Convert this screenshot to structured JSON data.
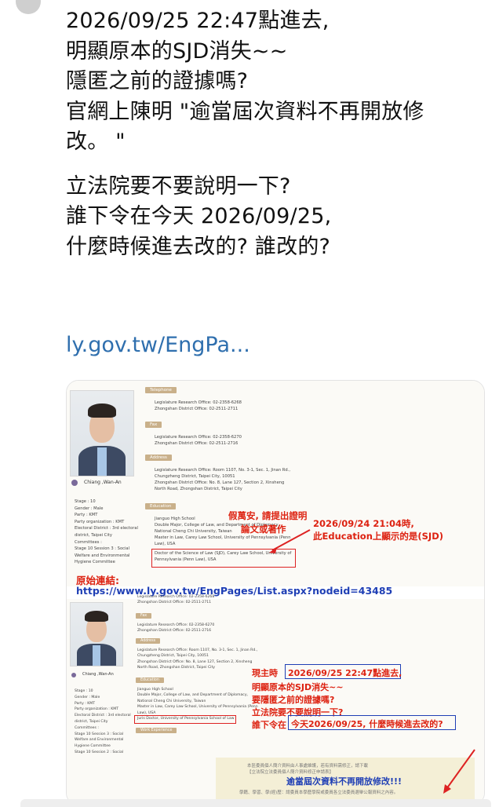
{
  "post": {
    "lines": [
      "2026/09/25 22:47點進去,",
      "明顯原本的SJD消失~~",
      "隱匿之前的證據嗎?",
      "官網上陳明 \"逾當屆次資料不再開放修",
      "改。 \"",
      "立法院要不要說明一下?",
      "誰下令在今天 2026/09/25,",
      "什麼時候進去改的? 誰改的?"
    ],
    "link": "ly.gov.tw/EngPa..."
  },
  "panel1": {
    "name": "Chiang ,Wan-An",
    "profile": [
      "Stage : 10",
      "Gender : Male",
      "Party : KMT",
      "Party organization : KMT",
      "Electoral District : 3rd electoral",
      "district, Taipei City",
      "Committees :",
      "Stage 10 Session 3 : Social",
      "Welfare and Environmental",
      "Hygiene Committee"
    ],
    "sections": {
      "telephone": "Telephone",
      "fax": "Fax",
      "address": "Address",
      "education": "Education"
    },
    "telephone": [
      "Legislature Research Office: 02-2358-6268",
      "Zhongshan District Office: 02-2511-2711"
    ],
    "fax": [
      "Legislature Research Office: 02-2358-6270",
      "Zhongshan District Office: 02-2511-2716"
    ],
    "address": [
      "Legislature Research Office: Room 1107, No. 3-1, Sec. 1, Jinan Rd.,",
      "Chungzheng District, Taipei City, 10051",
      "Zhongshan District Office: No. 8, Lane 127, Section 2, Xinsheng",
      "North Road, Zhongshan District, Taipei City"
    ],
    "education": [
      "Jianguo High School",
      "Double Major, College of Law, and Department of Diplomacy,",
      "National Cheng Chi University, Taiwan",
      "Master in Law, Carey Law School, University of Pennsylvania (Penn",
      "Law), USA",
      "Doctor of the Science of Law (SJD), Carey Law School, University of",
      "Pennsylvania (Penn Law), USA"
    ],
    "annotation_red1": "假萬安, 請提出證明",
    "annotation_red2": "論文或著作",
    "annotation_red3": "2026/09/24 21:04時,",
    "annotation_red4": "此Education上顯示的是(SJD)",
    "url_label": "原始連結:",
    "url": "https://www.ly.gov.tw/EngPages/List.aspx?nodeid=43485"
  },
  "panel2": {
    "name": "Chiang ,Wan-An",
    "profile": [
      "Stage : 10",
      "Gender : Male",
      "Party : KMT",
      "Party organization : KMT",
      "Electoral District : 3rd electoral",
      "district, Taipei City",
      "Committees :",
      "Stage 10 Session 3 : Social",
      "Welfare and Environmental",
      "Hygiene Committee",
      "Stage 10 Session 2 : Social"
    ],
    "sections": {
      "fax": "Fax",
      "address": "Address",
      "education": "Education",
      "work": "Work Experience"
    },
    "telephone": [
      "Legislature Research Office: 02-2358-6268",
      "Zhongshan District Office: 02-2511-2711"
    ],
    "fax": [
      "Legislature Research Office: 02-2358-6270",
      "Zhongshan District Office: 02-2511-2716"
    ],
    "address": [
      "Legislature Research Office: Room 1107, No. 3-1, Sec. 1, Jinan Rd.,",
      "Chungzheng District, Taipei City, 10051",
      "Zhongshan District Office: No. 8, Lane 127, Section 2, Xinsheng",
      "North Road, Zhongshan District, Taipei City"
    ],
    "education": [
      "Jianguo High School",
      "Double Major, College of Law, and Department of Diplomacy,",
      "National Cheng Chi University, Taiwan",
      "Master in Law, Carey Law School, University of Pennsylvania (Penn",
      "Law), USA",
      "Juris Doctor, University of Pennsylvania School of Law"
    ],
    "ann_a": "現主時",
    "ann_b": "2026/09/25 22:47點進去,",
    "ann_c": "明顯原本的SJD消失~~",
    "ann_d": "要隱匿之前的證據嗎?",
    "ann_e": "立法院要不要說明一下?",
    "ann_f": "誰下令在",
    "ann_g": "今天2026/09/25, 什麼時候進去改的?",
    "notice_1": "本區委員個人簡介資料由人事處維護，若有資料需修正，請下載",
    "notice_2": "【立法院立法委員個人簡介資料修正申請表】",
    "notice_3": "逾當屆次資料不再開放修改!!!",
    "notice_4": "學籍、學習、學(經)歷：請委員本學歷學院或委員各立法委員選舉公報資料之內容。"
  }
}
